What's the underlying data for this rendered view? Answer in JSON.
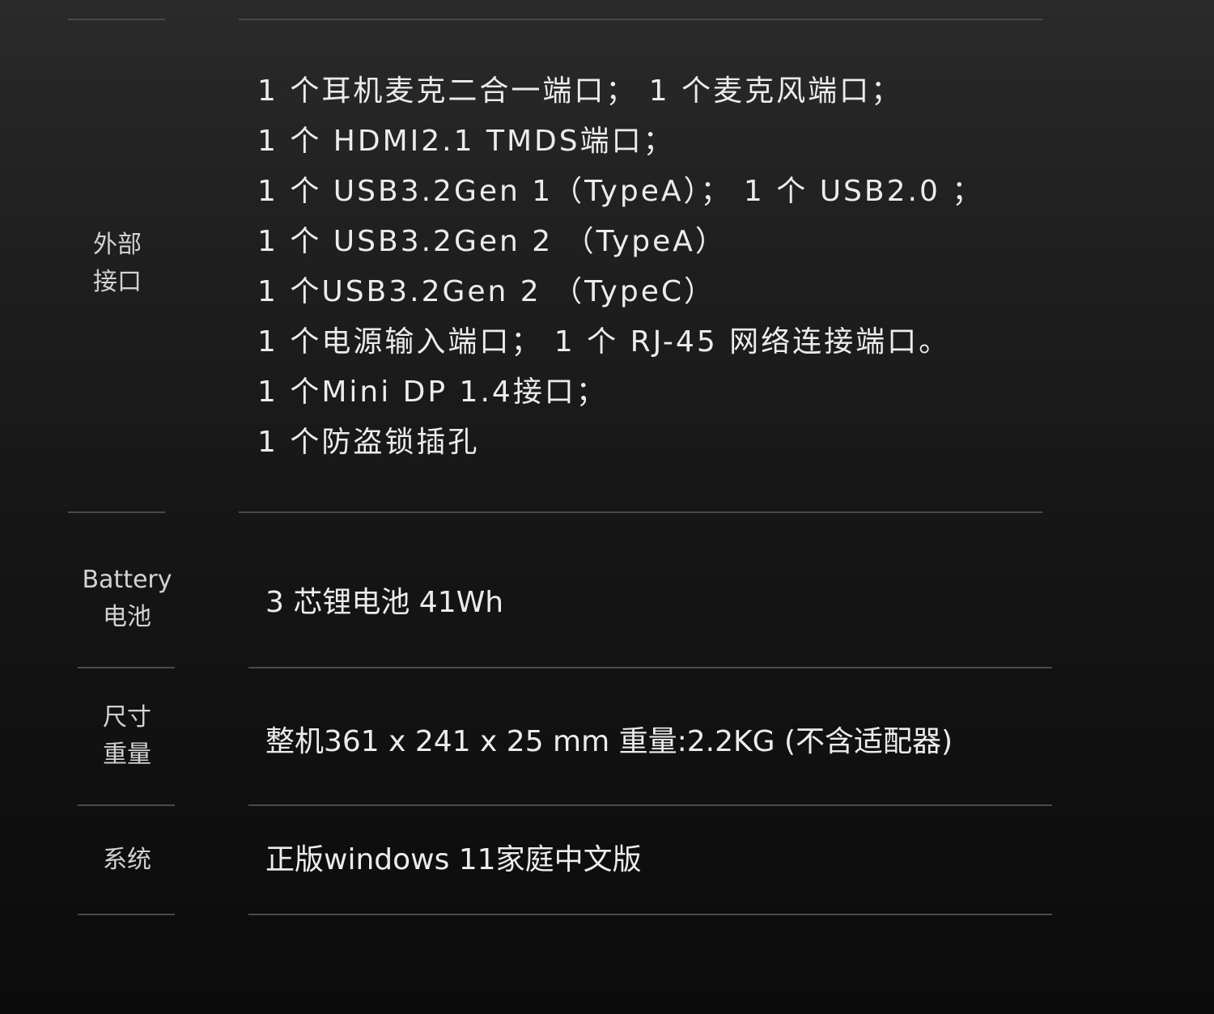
{
  "specs": {
    "ports": {
      "label_line1": "外部",
      "label_line2": "接口",
      "lines": [
        "1 个耳机麦克二合一端口； 1 个麦克风端口；",
        "1 个 HDMI2.1 TMDS端口；",
        "1 个 USB3.2Gen 1（TypeA）； 1 个 USB2.0 ；",
        "1 个 USB3.2Gen 2 （TypeA）",
        "1 个USB3.2Gen 2 （TypeC）",
        "1 个电源输入端口； 1 个 RJ-45 网络连接端口。",
        "1 个Mini DP 1.4接口；",
        "1 个防盗锁插孔"
      ]
    },
    "battery": {
      "label_line1": "Battery",
      "label_line2": "电池",
      "value": "3 芯锂电池 41Wh"
    },
    "size": {
      "label_line1": "尺寸",
      "label_line2": "重量",
      "value": "整机361 x 241 x 25 mm 重量:2.2KG (不含适配器)"
    },
    "os": {
      "label": "系统",
      "value": "正版windows 11家庭中文版"
    }
  }
}
